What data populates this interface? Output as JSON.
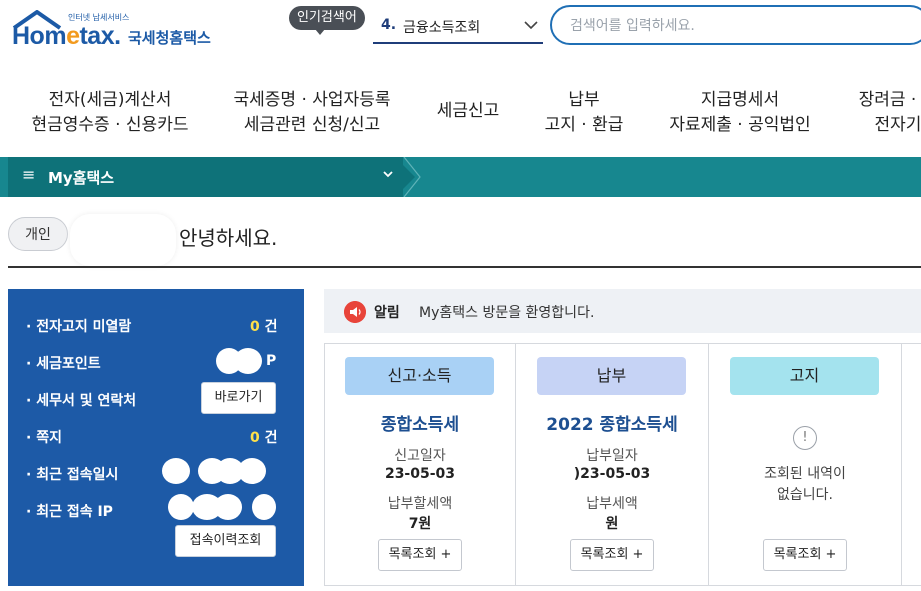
{
  "header": {
    "logo_tagline": "인터넷 납세서비스",
    "logo_home": "Hom",
    "logo_e": "e",
    "logo_tax": "tax.",
    "logo_korean": "국세청홈택스",
    "popular_label": "인기검색어",
    "popular_rank": "4.",
    "popular_term": "금융소득조회",
    "search_placeholder": "검색어를 입력하세요."
  },
  "menu": [
    {
      "line1": "전자(세금)계산서",
      "line2": "현금영수증 · 신용카드"
    },
    {
      "line1": "국세증명 · 사업자등록",
      "line2": "세금관련 신청/신고"
    },
    {
      "line1": "세금신고",
      "line2": ""
    },
    {
      "line1": "납부",
      "line2": "고지 · 환급"
    },
    {
      "line1": "지급명세서",
      "line2": "자료제출 · 공익법인"
    },
    {
      "line1": "장려금 · 연",
      "line2": "전자기"
    }
  ],
  "nav": {
    "hamburger": "≡",
    "title": "My홈택스",
    "chevron": "⌄"
  },
  "greeting": {
    "type": "개인",
    "text": "안녕하세요."
  },
  "side": {
    "rows": [
      {
        "label": "전자고지 미열람",
        "value": "0",
        "unit": "건"
      },
      {
        "label": "세금포인트",
        "value": "",
        "unit": "P"
      },
      {
        "label": "세무서 및 연락처",
        "button": "바로가기"
      },
      {
        "label": "쪽지",
        "value": "0",
        "unit": "건"
      },
      {
        "label": "최근 접속일시",
        "value": ""
      },
      {
        "label": "최근 접속 IP",
        "value": ""
      }
    ],
    "history_button": "접속이력조회"
  },
  "notice": {
    "icon": "◀)",
    "tag": "알림",
    "text": "My홈택스 방문을 환영합니다."
  },
  "cards": [
    {
      "badge": "신고·소득",
      "badge_color": "#a9d1f5",
      "title": "종합소득세",
      "label1": "신고일자",
      "value1": "23-05-03",
      "label2": "납부할세액",
      "value2": "7원",
      "button": "목록조회 +"
    },
    {
      "badge": "납부",
      "badge_color": "#c6d3f5",
      "title": "2022 종합소득세",
      "label1": "납부일자",
      "value1": ")23-05-03",
      "label2": "납부세액",
      "value2": "원",
      "button": "목록조회 +"
    },
    {
      "badge": "고지",
      "badge_color": "#a4e3ee",
      "empty_icon": "!",
      "empty_line1": "조회된 내역이",
      "empty_line2": "없습니다.",
      "button": "목록조회 +"
    }
  ]
}
